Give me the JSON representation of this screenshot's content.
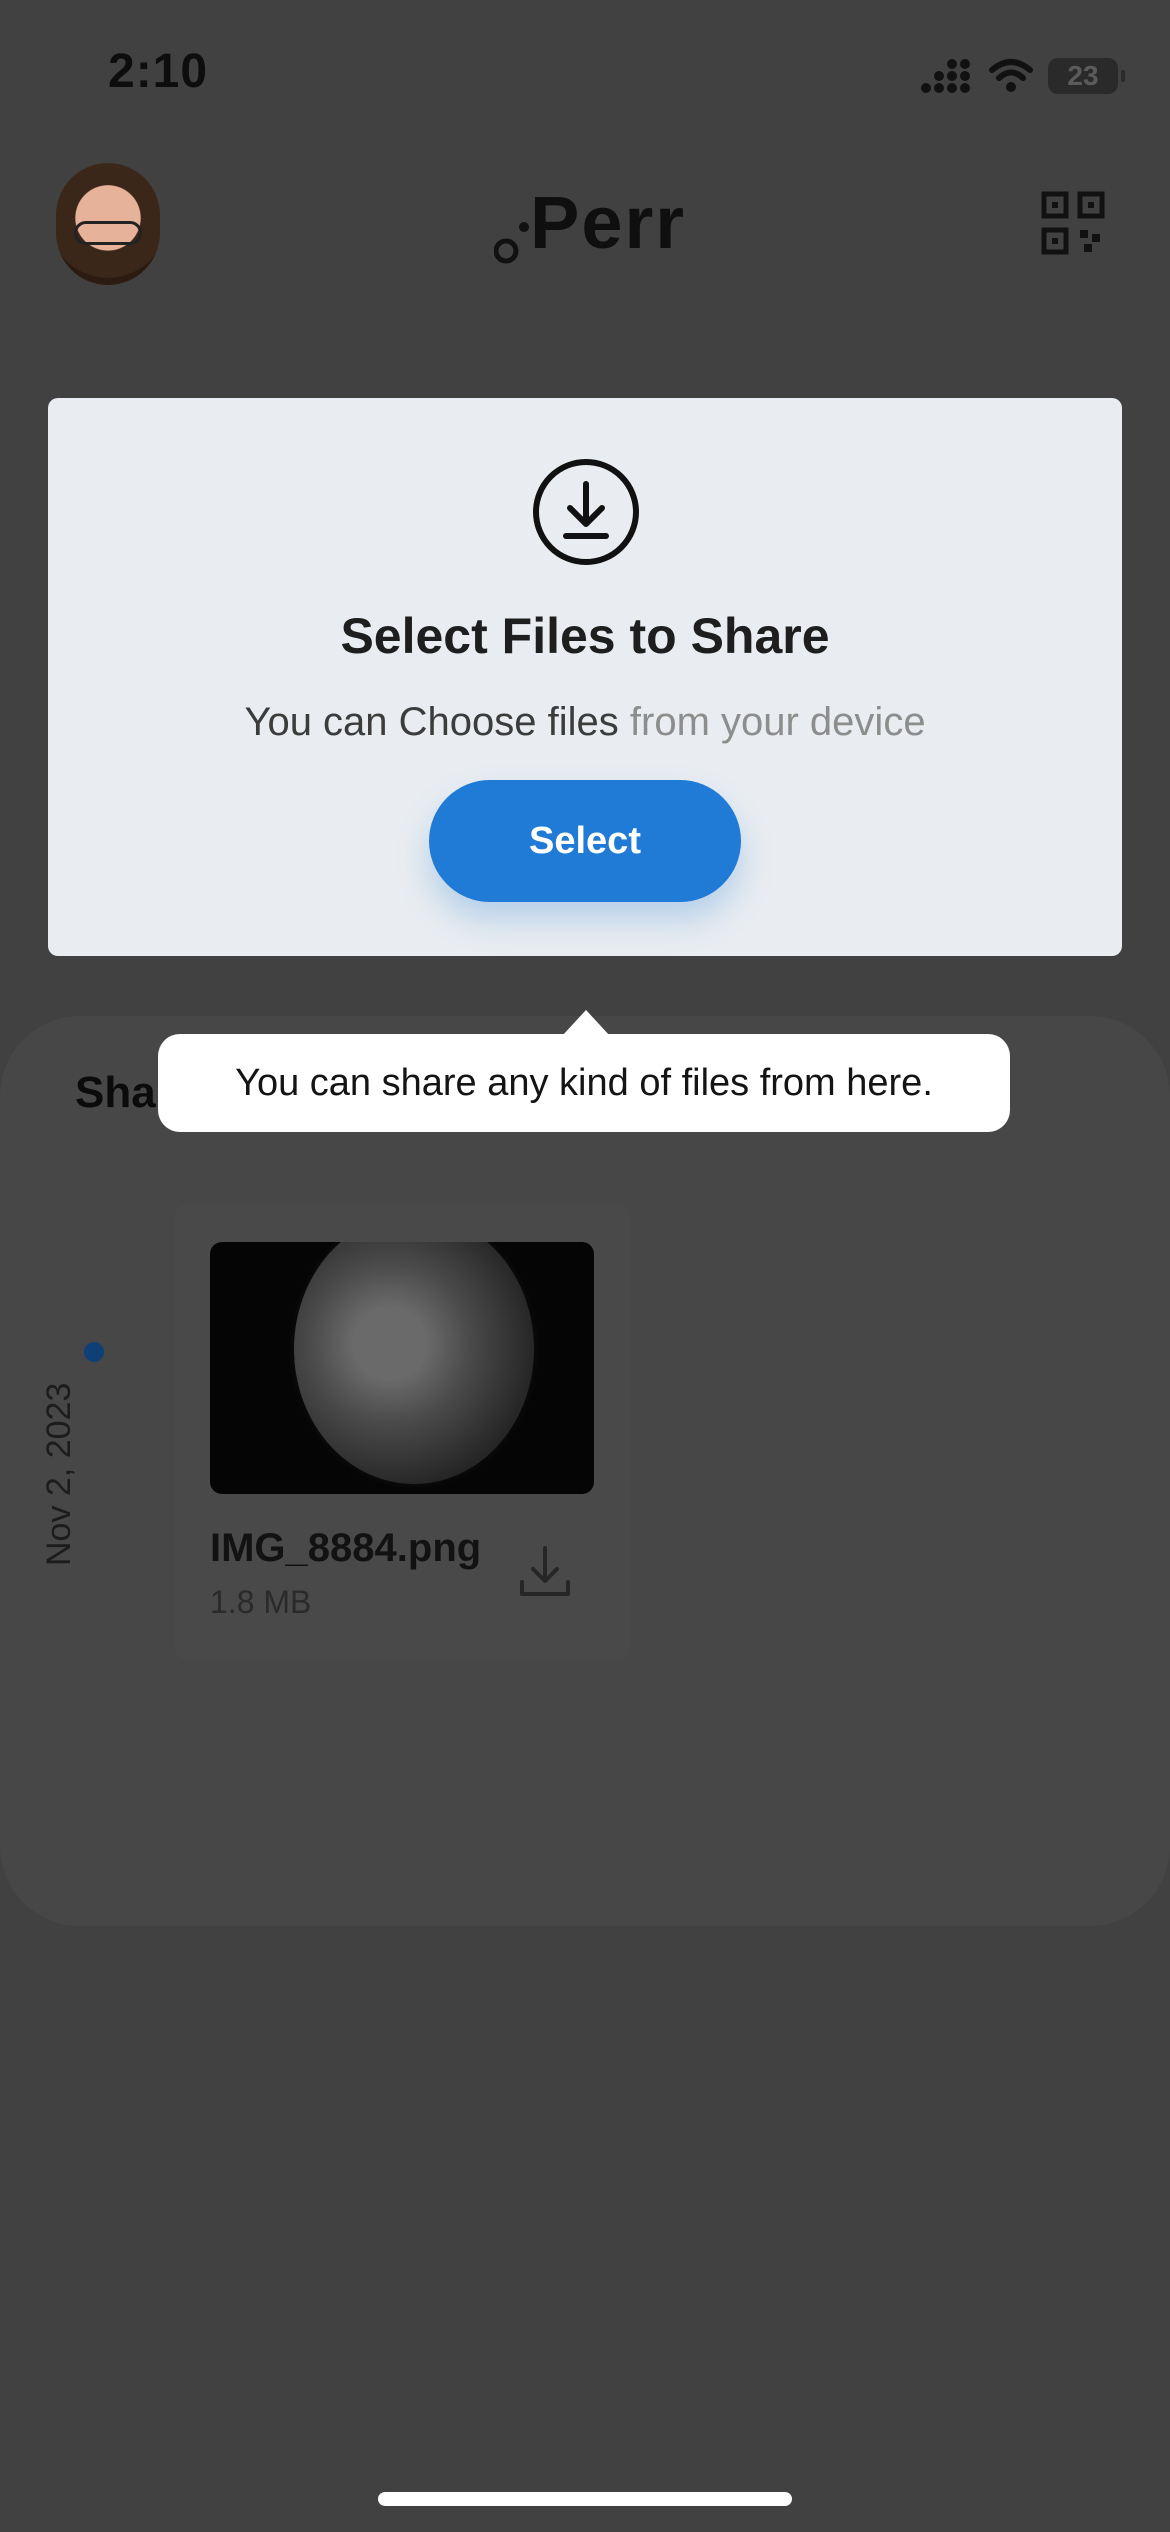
{
  "status": {
    "time": "2:10",
    "battery": "23"
  },
  "header": {
    "logo_text": "Perr"
  },
  "select_card": {
    "title": "Select Files to Share",
    "subtitle_bold": "You can Choose files",
    "subtitle_light": " from your device",
    "select_button": "Select"
  },
  "tooltip": {
    "text": "You can share any kind of files from here."
  },
  "shared_section": {
    "title_visible": "Sha"
  },
  "timeline": {
    "date": "Nov 2, 2023"
  },
  "file": {
    "name": "IMG_8884.png",
    "size": "1.8 MB"
  },
  "colors": {
    "background": "#414141",
    "accent": "#1f7bd6",
    "card": "#e9edf1"
  },
  "icons": {
    "signal": "cellular-signal-icon",
    "wifi": "wifi-icon",
    "battery": "battery-icon",
    "qr": "qr-code-icon",
    "download": "download-icon"
  }
}
